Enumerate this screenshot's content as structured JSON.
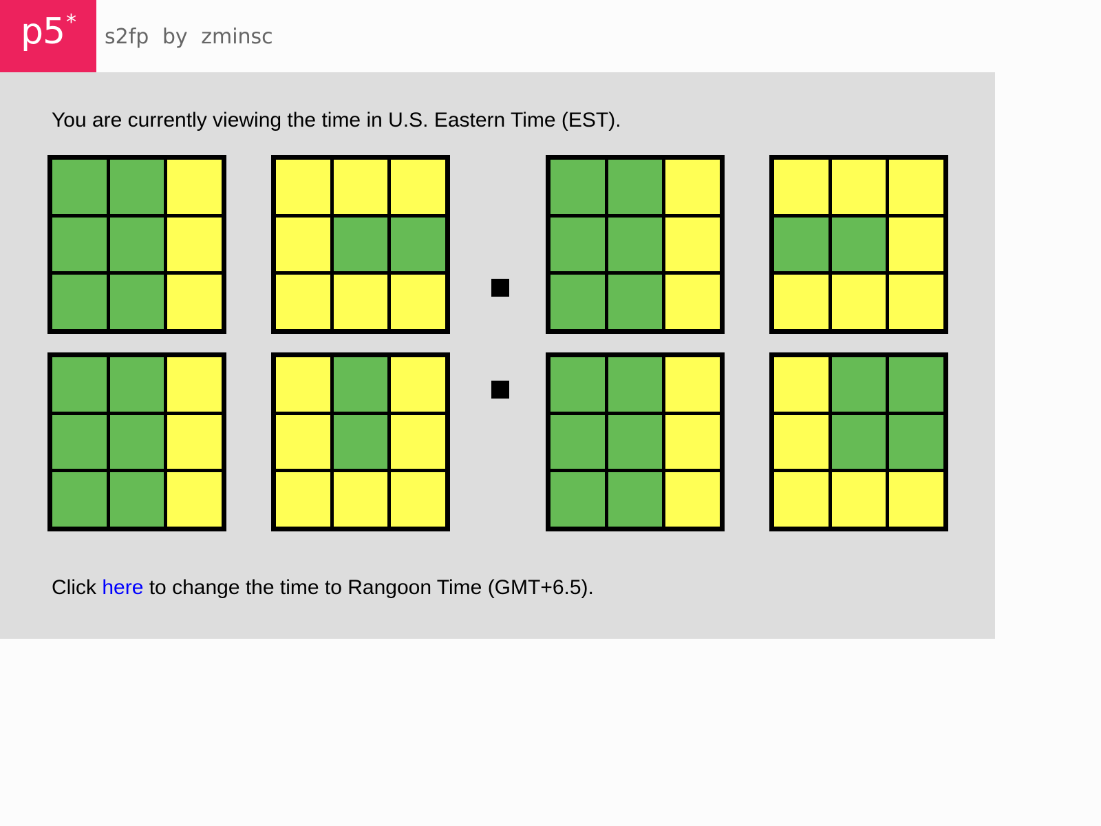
{
  "header": {
    "logo_text": "p5",
    "logo_star": "*",
    "sketch_name": "s2fp",
    "by_label": "by",
    "author": "zminsc"
  },
  "canvas": {
    "status_text": "You are currently viewing the time in U.S. Eastern Time (EST).",
    "click_prefix": "Click ",
    "click_link_text": "here",
    "click_suffix": " to change the time to Rangoon Time (GMT+6.5)."
  },
  "colors": {
    "on": "#66bb55",
    "off": "#ffff55",
    "brand": "#ed225d",
    "link": "#0000ff",
    "canvas_bg": "#dddddd"
  },
  "grids": [
    {
      "id": "g-h1",
      "cells": [
        1,
        1,
        0,
        1,
        1,
        0,
        1,
        1,
        0
      ]
    },
    {
      "id": "g-h2",
      "cells": [
        0,
        0,
        0,
        0,
        1,
        1,
        0,
        0,
        0
      ]
    },
    {
      "id": "g-m1",
      "cells": [
        1,
        1,
        0,
        1,
        1,
        0,
        1,
        1,
        0
      ]
    },
    {
      "id": "g-m2",
      "cells": [
        0,
        0,
        0,
        1,
        1,
        0,
        0,
        0,
        0
      ]
    },
    {
      "id": "g-s1",
      "cells": [
        1,
        1,
        0,
        1,
        1,
        0,
        1,
        1,
        0
      ]
    },
    {
      "id": "g-s2",
      "cells": [
        0,
        1,
        0,
        0,
        1,
        0,
        0,
        0,
        0
      ]
    },
    {
      "id": "g-s3",
      "cells": [
        1,
        1,
        0,
        1,
        1,
        0,
        1,
        1,
        0
      ]
    },
    {
      "id": "g-s4",
      "cells": [
        0,
        1,
        1,
        0,
        1,
        1,
        0,
        0,
        0
      ]
    }
  ]
}
